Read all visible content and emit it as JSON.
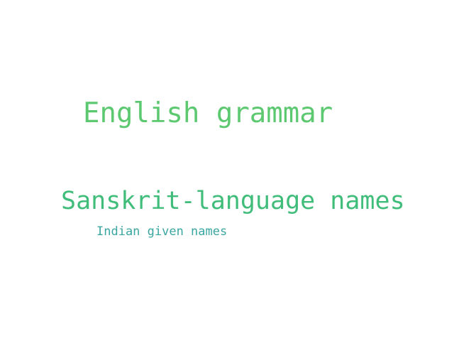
{
  "words": [
    {
      "text": "English grammar",
      "color": "#5cc870"
    },
    {
      "text": "Sanskrit-language names",
      "color": "#40bd7a"
    },
    {
      "text": "Indian given names",
      "color": "#3aa6a0"
    }
  ]
}
